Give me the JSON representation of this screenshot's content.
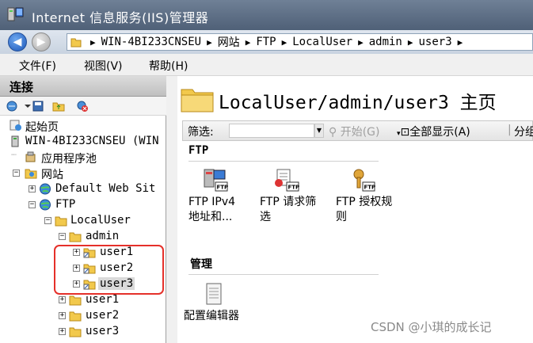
{
  "window": {
    "title": "Internet 信息服务(IIS)管理器"
  },
  "address": {
    "segments": [
      "WIN-4BI233CNSEU",
      "网站",
      "FTP",
      "LocalUser",
      "admin",
      "user3"
    ],
    "trailing_sep": "▶"
  },
  "menu": {
    "file": "文件(F)",
    "view": "视图(V)",
    "help": "帮助(H)"
  },
  "connections": {
    "header": "连接",
    "tree": [
      {
        "label": "起始页",
        "icon": "start-page-icon"
      },
      {
        "label": "WIN-4BI233CNSEU (WIN",
        "icon": "server-icon"
      },
      {
        "label": "应用程序池",
        "icon": "app-pool-icon"
      },
      {
        "label": "网站",
        "icon": "sites-icon"
      },
      {
        "label": "Default Web Sit",
        "icon": "globe-icon"
      },
      {
        "label": "FTP",
        "icon": "globe-icon"
      },
      {
        "label": "LocalUser",
        "icon": "folder-icon"
      },
      {
        "label": "admin",
        "icon": "folder-icon"
      },
      {
        "label": "user1",
        "icon": "virtual-folder-icon"
      },
      {
        "label": "user2",
        "icon": "virtual-folder-icon"
      },
      {
        "label": "user3",
        "icon": "virtual-folder-icon",
        "selected": true
      },
      {
        "label": "user1",
        "icon": "folder-icon"
      },
      {
        "label": "user2",
        "icon": "folder-icon"
      },
      {
        "label": "user3",
        "icon": "folder-icon"
      }
    ]
  },
  "main": {
    "title": "LocalUser/admin/user3 主页",
    "filter_label": "筛选:",
    "start_label": "开始(G)",
    "show_all_label": "全部显示(A)",
    "group_by_label": "分组",
    "groups": [
      {
        "name": "FTP",
        "features": [
          {
            "label": "FTP IPv4\n地址和...",
            "icon": "ftp-ipv4-icon"
          },
          {
            "label": "FTP 请求筛\n选",
            "icon": "ftp-request-filter-icon"
          },
          {
            "label": "FTP 授权规\n则",
            "icon": "ftp-authorization-icon"
          }
        ]
      },
      {
        "name": "管理",
        "features": [
          {
            "label": "配置编辑器",
            "icon": "config-editor-icon"
          }
        ]
      }
    ]
  },
  "watermark": "CSDN @小琪的成长记",
  "colors": {
    "titlebar": "#5a6b82",
    "highlight": "#e5302a",
    "folder": "#f2c94c"
  }
}
